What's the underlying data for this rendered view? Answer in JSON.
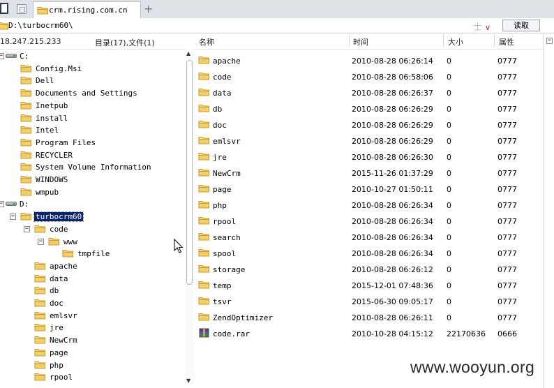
{
  "tab": {
    "title": "crm.rising.com.cn"
  },
  "address": {
    "path": "D:\\turbocrm60\\",
    "read_button": "读取",
    "tools": "士",
    "dropdown": "∨"
  },
  "status": {
    "ip": "18.247.215.233",
    "counts": "目录(17),文件(1)"
  },
  "columns": {
    "name": "名称",
    "time": "时间",
    "size": "大小",
    "attr": "属性"
  },
  "tree": {
    "drive_c": "C:",
    "c_items": [
      "Config.Msi",
      "Dell",
      "Documents and Settings",
      "Inetpub",
      "install",
      "Intel",
      "Program Files",
      "RECYCLER",
      "System Volume Information",
      "WINDOWS",
      "wmpub"
    ],
    "drive_d": "D:",
    "selected": "turbocrm60",
    "code": "code",
    "www": "www",
    "tmpfile": "tmpfile",
    "d_items": [
      "apache",
      "data",
      "db",
      "doc",
      "emlsvr",
      "jre",
      "NewCrm",
      "page",
      "php",
      "rpool"
    ]
  },
  "files": [
    {
      "name": "apache",
      "time": "2010-08-28 06:26:14",
      "size": "0",
      "attr": "0777",
      "type": "folder"
    },
    {
      "name": "code",
      "time": "2010-08-28 06:58:06",
      "size": "0",
      "attr": "0777",
      "type": "folder"
    },
    {
      "name": "data",
      "time": "2010-08-28 06:26:37",
      "size": "0",
      "attr": "0777",
      "type": "folder"
    },
    {
      "name": "db",
      "time": "2010-08-28 06:26:29",
      "size": "0",
      "attr": "0777",
      "type": "folder"
    },
    {
      "name": "doc",
      "time": "2010-08-28 06:26:29",
      "size": "0",
      "attr": "0777",
      "type": "folder"
    },
    {
      "name": "emlsvr",
      "time": "2010-08-28 06:26:29",
      "size": "0",
      "attr": "0777",
      "type": "folder"
    },
    {
      "name": "jre",
      "time": "2010-08-28 06:26:30",
      "size": "0",
      "attr": "0777",
      "type": "folder"
    },
    {
      "name": "NewCrm",
      "time": "2015-11-26 01:37:29",
      "size": "0",
      "attr": "0777",
      "type": "folder"
    },
    {
      "name": "page",
      "time": "2010-10-27 01:50:11",
      "size": "0",
      "attr": "0777",
      "type": "folder"
    },
    {
      "name": "php",
      "time": "2010-08-28 06:26:34",
      "size": "0",
      "attr": "0777",
      "type": "folder"
    },
    {
      "name": "rpool",
      "time": "2010-08-28 06:26:34",
      "size": "0",
      "attr": "0777",
      "type": "folder"
    },
    {
      "name": "search",
      "time": "2010-08-28 06:26:34",
      "size": "0",
      "attr": "0777",
      "type": "folder"
    },
    {
      "name": "spool",
      "time": "2010-08-28 06:26:34",
      "size": "0",
      "attr": "0777",
      "type": "folder"
    },
    {
      "name": "storage",
      "time": "2010-08-28 06:26:12",
      "size": "0",
      "attr": "0777",
      "type": "folder"
    },
    {
      "name": "temp",
      "time": "2015-12-01 07:48:36",
      "size": "0",
      "attr": "0777",
      "type": "folder"
    },
    {
      "name": "tsvr",
      "time": "2015-06-30 09:05:17",
      "size": "0",
      "attr": "0777",
      "type": "folder"
    },
    {
      "name": "ZendOptimizer",
      "time": "2010-08-28 06:26:11",
      "size": "0",
      "attr": "0777",
      "type": "folder"
    },
    {
      "name": "code.rar",
      "time": "2010-10-28 04:15:12",
      "size": "22170636",
      "attr": "0666",
      "type": "archive"
    }
  ],
  "watermark": "www.wooyun.org",
  "colors": {
    "folder": "#f3cf6a",
    "folder_edge": "#c99a2e",
    "selection": "#0a246a",
    "tabbar": "#dfe3e8"
  },
  "icons": {
    "folder": "folder-icon",
    "archive": "rar-archive-icon",
    "drive": "hard-drive-icon"
  }
}
